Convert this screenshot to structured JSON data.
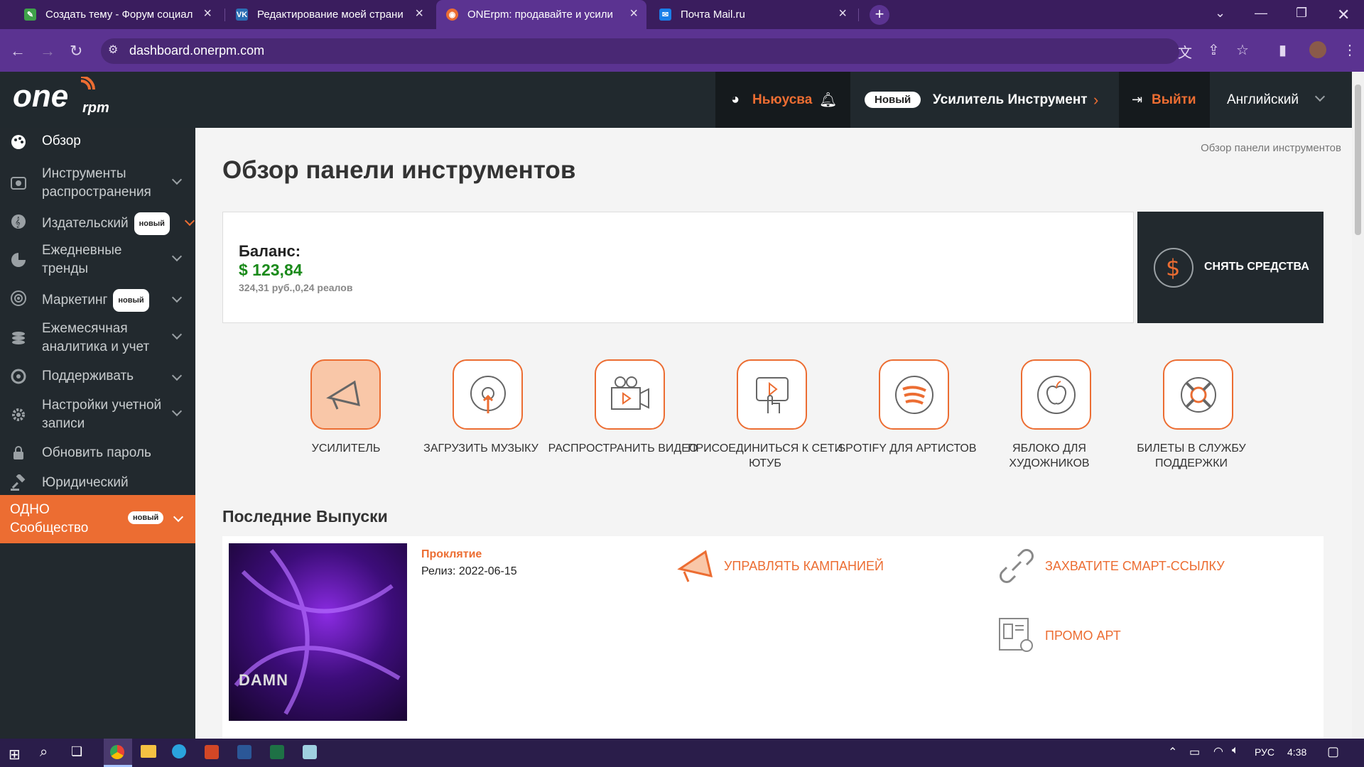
{
  "browser": {
    "tabs": [
      {
        "title": "Создать тему - Форум социал",
        "icon": "forum-icon",
        "color": "#3fa14a"
      },
      {
        "title": "Редактирование моей страни",
        "icon": "vk-icon",
        "color": "#2b6eb4"
      },
      {
        "title": "ONErpm: продавайте и усили",
        "icon": "onerpm-icon",
        "color": "#ec6d32"
      },
      {
        "title": "Почта Mail.ru",
        "icon": "mail-icon",
        "color": "#1a7ee8"
      }
    ],
    "url": "dashboard.onerpm.com"
  },
  "header": {
    "logo": "ONErpm",
    "user": "Ньюусва",
    "new_badge": "Новый",
    "tool_label": "Усилитель Инструмент",
    "logout": "Выйти",
    "language": "Английский"
  },
  "sidebar": {
    "items": [
      {
        "label": "Обзор",
        "icon": "palette-icon"
      },
      {
        "label": "Инструменты распространения",
        "icon": "distribution-icon"
      },
      {
        "label": "Издательский",
        "icon": "publishing-icon",
        "badge": "новый"
      },
      {
        "label": "Ежедневные тренды",
        "icon": "pie-chart-icon"
      },
      {
        "label": "Маркетинг",
        "icon": "target-icon",
        "badge": "новый"
      },
      {
        "label": "Ежемесячная аналитика и учет",
        "icon": "coins-icon"
      },
      {
        "label": "Поддерживать",
        "icon": "support-icon"
      },
      {
        "label": "Настройки учетной записи",
        "icon": "gear-icon"
      },
      {
        "label": "Обновить пароль",
        "icon": "lock-icon"
      },
      {
        "label": "Юридический",
        "icon": "gavel-icon"
      }
    ],
    "community": {
      "label": "ОДНО Сообщество",
      "badge": "новый"
    }
  },
  "main": {
    "breadcrumb": "Обзор панели инструментов",
    "title": "Обзор панели инструментов",
    "balance_label": "Баланс:",
    "balance_value": "$ 123,84",
    "balance_sub": "324,31 руб.,0,24 реалов",
    "withdraw": "СНЯТЬ СРЕДСТВА",
    "quick_links": [
      "Усилитель",
      "Загрузить музыку",
      "Распространить видео",
      "Присоединиться к сети ютуб",
      "Spotify для артистов",
      "Яблоко для художников",
      "Билеты в службу поддержки"
    ],
    "latest_title": "Последние Выпуски",
    "release": {
      "name": "Проклятие",
      "date": "Релиз: 2022-06-15",
      "cover_text": "DAMN",
      "manage": "УПРАВЛЯТЬ КАМПАНИЕЙ",
      "smart_link": "ЗАХВАТИТЕ СМАРТ-ССЫЛКУ",
      "promo": "ПРОМО АРТ"
    }
  },
  "taskbar": {
    "lang": "РУС",
    "time": "4:38"
  },
  "colors": {
    "accent": "#ec6d32",
    "green": "#1a8a1a",
    "dark": "#22292e",
    "browser": "#5b3391"
  }
}
